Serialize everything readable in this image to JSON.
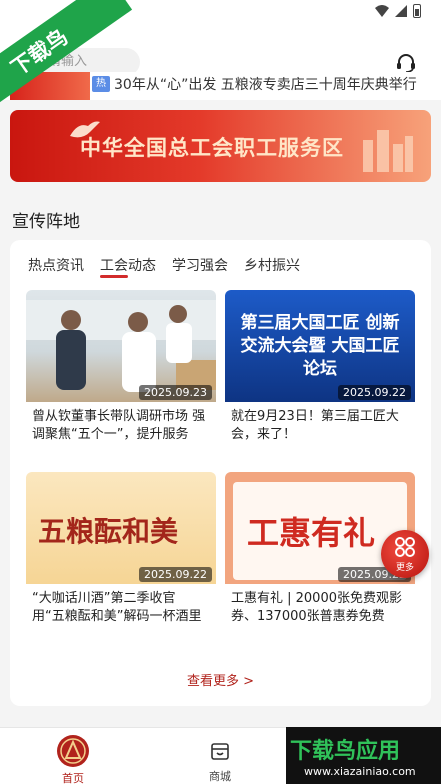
{
  "watermark": {
    "corner_text": "下载鸟",
    "bottom_text": "下载鸟应用",
    "bottom_url": "www.xiazainiao.com"
  },
  "header": {
    "search_placeholder": "请输入"
  },
  "ticker": {
    "badge": "热",
    "text": "30年从“心”出发 五粮液专卖店三十周年庆典举行"
  },
  "banner": {
    "text": "中华全国总工会职工服务区"
  },
  "section_title": "宣传阵地",
  "tabs": [
    {
      "label": "热点资讯"
    },
    {
      "label": "工会动态"
    },
    {
      "label": "学习强会"
    },
    {
      "label": "乡村振兴"
    }
  ],
  "news": [
    {
      "date": "2025.09.23",
      "title": "曾从钦董事长带队调研市场 强调聚焦“五个一”，提升服务"
    },
    {
      "date": "2025.09.22",
      "title": "就在9月23日！第三届工匠大会，来了！",
      "image_text": "第三届大国工匠 创新交流大会暨 大国工匠论坛"
    },
    {
      "date": "2025.09.22",
      "title": "“大咖话川酒”第二季收官 用“五粮酝和美”解码一杯酒里的",
      "image_text": "五粮酝和美"
    },
    {
      "date": "2025.09.22",
      "title": "工惠有礼 | 20000张免费观影券、137000张普惠券免费",
      "image_text": "工惠有礼"
    }
  ],
  "more_label": "查看更多 >",
  "float_button": {
    "label": "更多"
  },
  "bottom_nav": [
    {
      "label": "首页"
    },
    {
      "label": "商城"
    }
  ],
  "colors": {
    "accent": "#b1231c",
    "banner_red": "#d7231b",
    "blue_card": "#1b4aa8"
  }
}
